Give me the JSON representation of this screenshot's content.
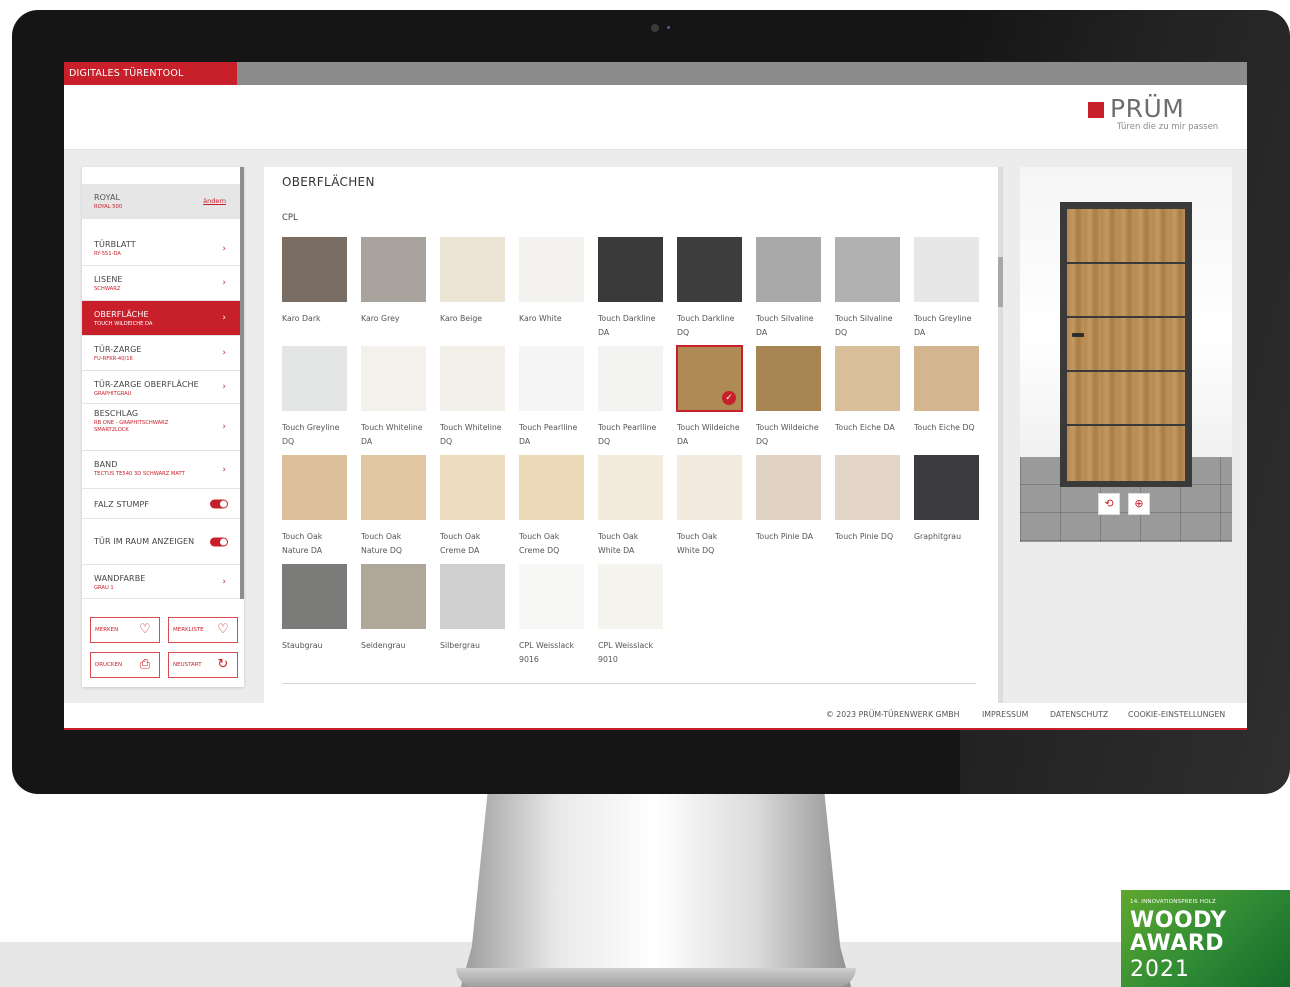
{
  "app": {
    "tool_tab": "DIGITALES TÜRENTOOL",
    "logo_text": "PRÜM",
    "logo_tagline": "Türen die zu mir passen",
    "brand_color": "#c8202a"
  },
  "sidebar": {
    "royal": {
      "title": "ROYAL",
      "sub": "ROYAL 500",
      "action": "ändern"
    },
    "items": [
      {
        "label": "TÜRBLATT",
        "value": "RY-551-DA",
        "active": false
      },
      {
        "label": "LISENE",
        "value": "SCHWARZ",
        "active": false
      },
      {
        "label": "OBERFLÄCHE",
        "value": "TOUCH WILDEICHE DA",
        "active": true
      },
      {
        "label": "TÜR-ZARGE",
        "value": "FU-RFKR-40/16",
        "active": false
      },
      {
        "label": "TÜR-ZARGE OBERFLÄCHE",
        "value": "GRAPHITGRAU",
        "active": false
      },
      {
        "label": "BESCHLAG",
        "value": "RB ONE - GRAPHITSCHWARZ SMART2LOCK",
        "active": false
      },
      {
        "label": "BAND",
        "value": "TECTUS TE540 3D SCHWARZ MATT",
        "active": false
      },
      {
        "label": "FALZ STUMPF",
        "value": "",
        "toggle": true
      },
      {
        "label": "TÜR IM RAUM ANZEIGEN",
        "value": "",
        "toggle": true
      },
      {
        "label": "WANDFARBE",
        "value": "GRAU 1",
        "active": false
      }
    ],
    "buttons": {
      "merken": "MERKEN",
      "merkliste": "MERKLISTE",
      "drucken": "DRUCKEN",
      "neustart": "NEUSTART"
    }
  },
  "main": {
    "title": "OBERFLÄCHEN",
    "category": "CPL",
    "swatches": [
      {
        "name": "Karo Dark",
        "color": "#7a6e64"
      },
      {
        "name": "Karo Grey",
        "color": "#a8a39c"
      },
      {
        "name": "Karo Beige",
        "color": "#ece5d6"
      },
      {
        "name": "Karo White",
        "color": "#f4f2ee"
      },
      {
        "name": "Touch Darkline DA",
        "color": "#3a3a3a"
      },
      {
        "name": "Touch Darkline DQ",
        "color": "#3d3d3d"
      },
      {
        "name": "Touch Silvaline DA",
        "color": "#a9a9a9"
      },
      {
        "name": "Touch Silvaline DQ",
        "color": "#b1b1b1"
      },
      {
        "name": "Touch Greyline DA",
        "color": "#e7e7e7"
      },
      {
        "name": "Touch Greyline DQ",
        "color": "#e4e6e6"
      },
      {
        "name": "Touch Whiteline DA",
        "color": "#f4f1ec"
      },
      {
        "name": "Touch Whiteline DQ",
        "color": "#f3efe9"
      },
      {
        "name": "Touch Pearlline DA",
        "color": "#f5f5f5"
      },
      {
        "name": "Touch Pearlline DQ",
        "color": "#f3f3f2"
      },
      {
        "name": "Touch Wildeiche DA",
        "color": "#b08a55",
        "selected": true
      },
      {
        "name": "Touch Wildeiche DQ",
        "color": "#a88654"
      },
      {
        "name": "Touch Eiche DA",
        "color": "#d9be9a"
      },
      {
        "name": "Touch Eiche DQ",
        "color": "#d3b690"
      },
      {
        "name": "Touch Oak Nature DA",
        "color": "#dcc09c"
      },
      {
        "name": "Touch Oak Nature DQ",
        "color": "#e0c6a3"
      },
      {
        "name": "Touch Oak Creme DA",
        "color": "#eddcbd"
      },
      {
        "name": "Touch Oak Creme DQ",
        "color": "#ecd9b8"
      },
      {
        "name": "Touch Oak White DA",
        "color": "#f4ebdd"
      },
      {
        "name": "Touch Oak White DQ",
        "color": "#f3ebdf"
      },
      {
        "name": "Touch Pinie DA",
        "color": "#e1d3c4"
      },
      {
        "name": "Touch Pinie DQ",
        "color": "#e3d6c8"
      },
      {
        "name": "Graphitgrau",
        "color": "#3c3c3e"
      },
      {
        "name": "Staubgrau",
        "color": "#7b7b7a"
      },
      {
        "name": "Seidengrau",
        "color": "#aea79a"
      },
      {
        "name": "Silbergrau",
        "color": "#cfcfcf"
      },
      {
        "name": "CPL Weisslack 9016",
        "color": "#f7f7f5"
      },
      {
        "name": "CPL Weisslack 9010",
        "color": "#f5f4ee"
      }
    ]
  },
  "preview": {
    "rotate_icon": "rotate-3d-icon",
    "zoom_icon": "zoom-in-icon"
  },
  "footer": {
    "copyright": "© 2023 PRÜM-TÜRENWERK GMBH",
    "impressum": "IMPRESSUM",
    "datenschutz": "DATENSCHUTZ",
    "cookies": "COOKIE-EINSTELLUNGEN"
  },
  "badge": {
    "line1": "14. INNOVATIONSPREIS HOLZ",
    "line2": "WOODY",
    "line3": "AWARD",
    "line4": "2021"
  }
}
